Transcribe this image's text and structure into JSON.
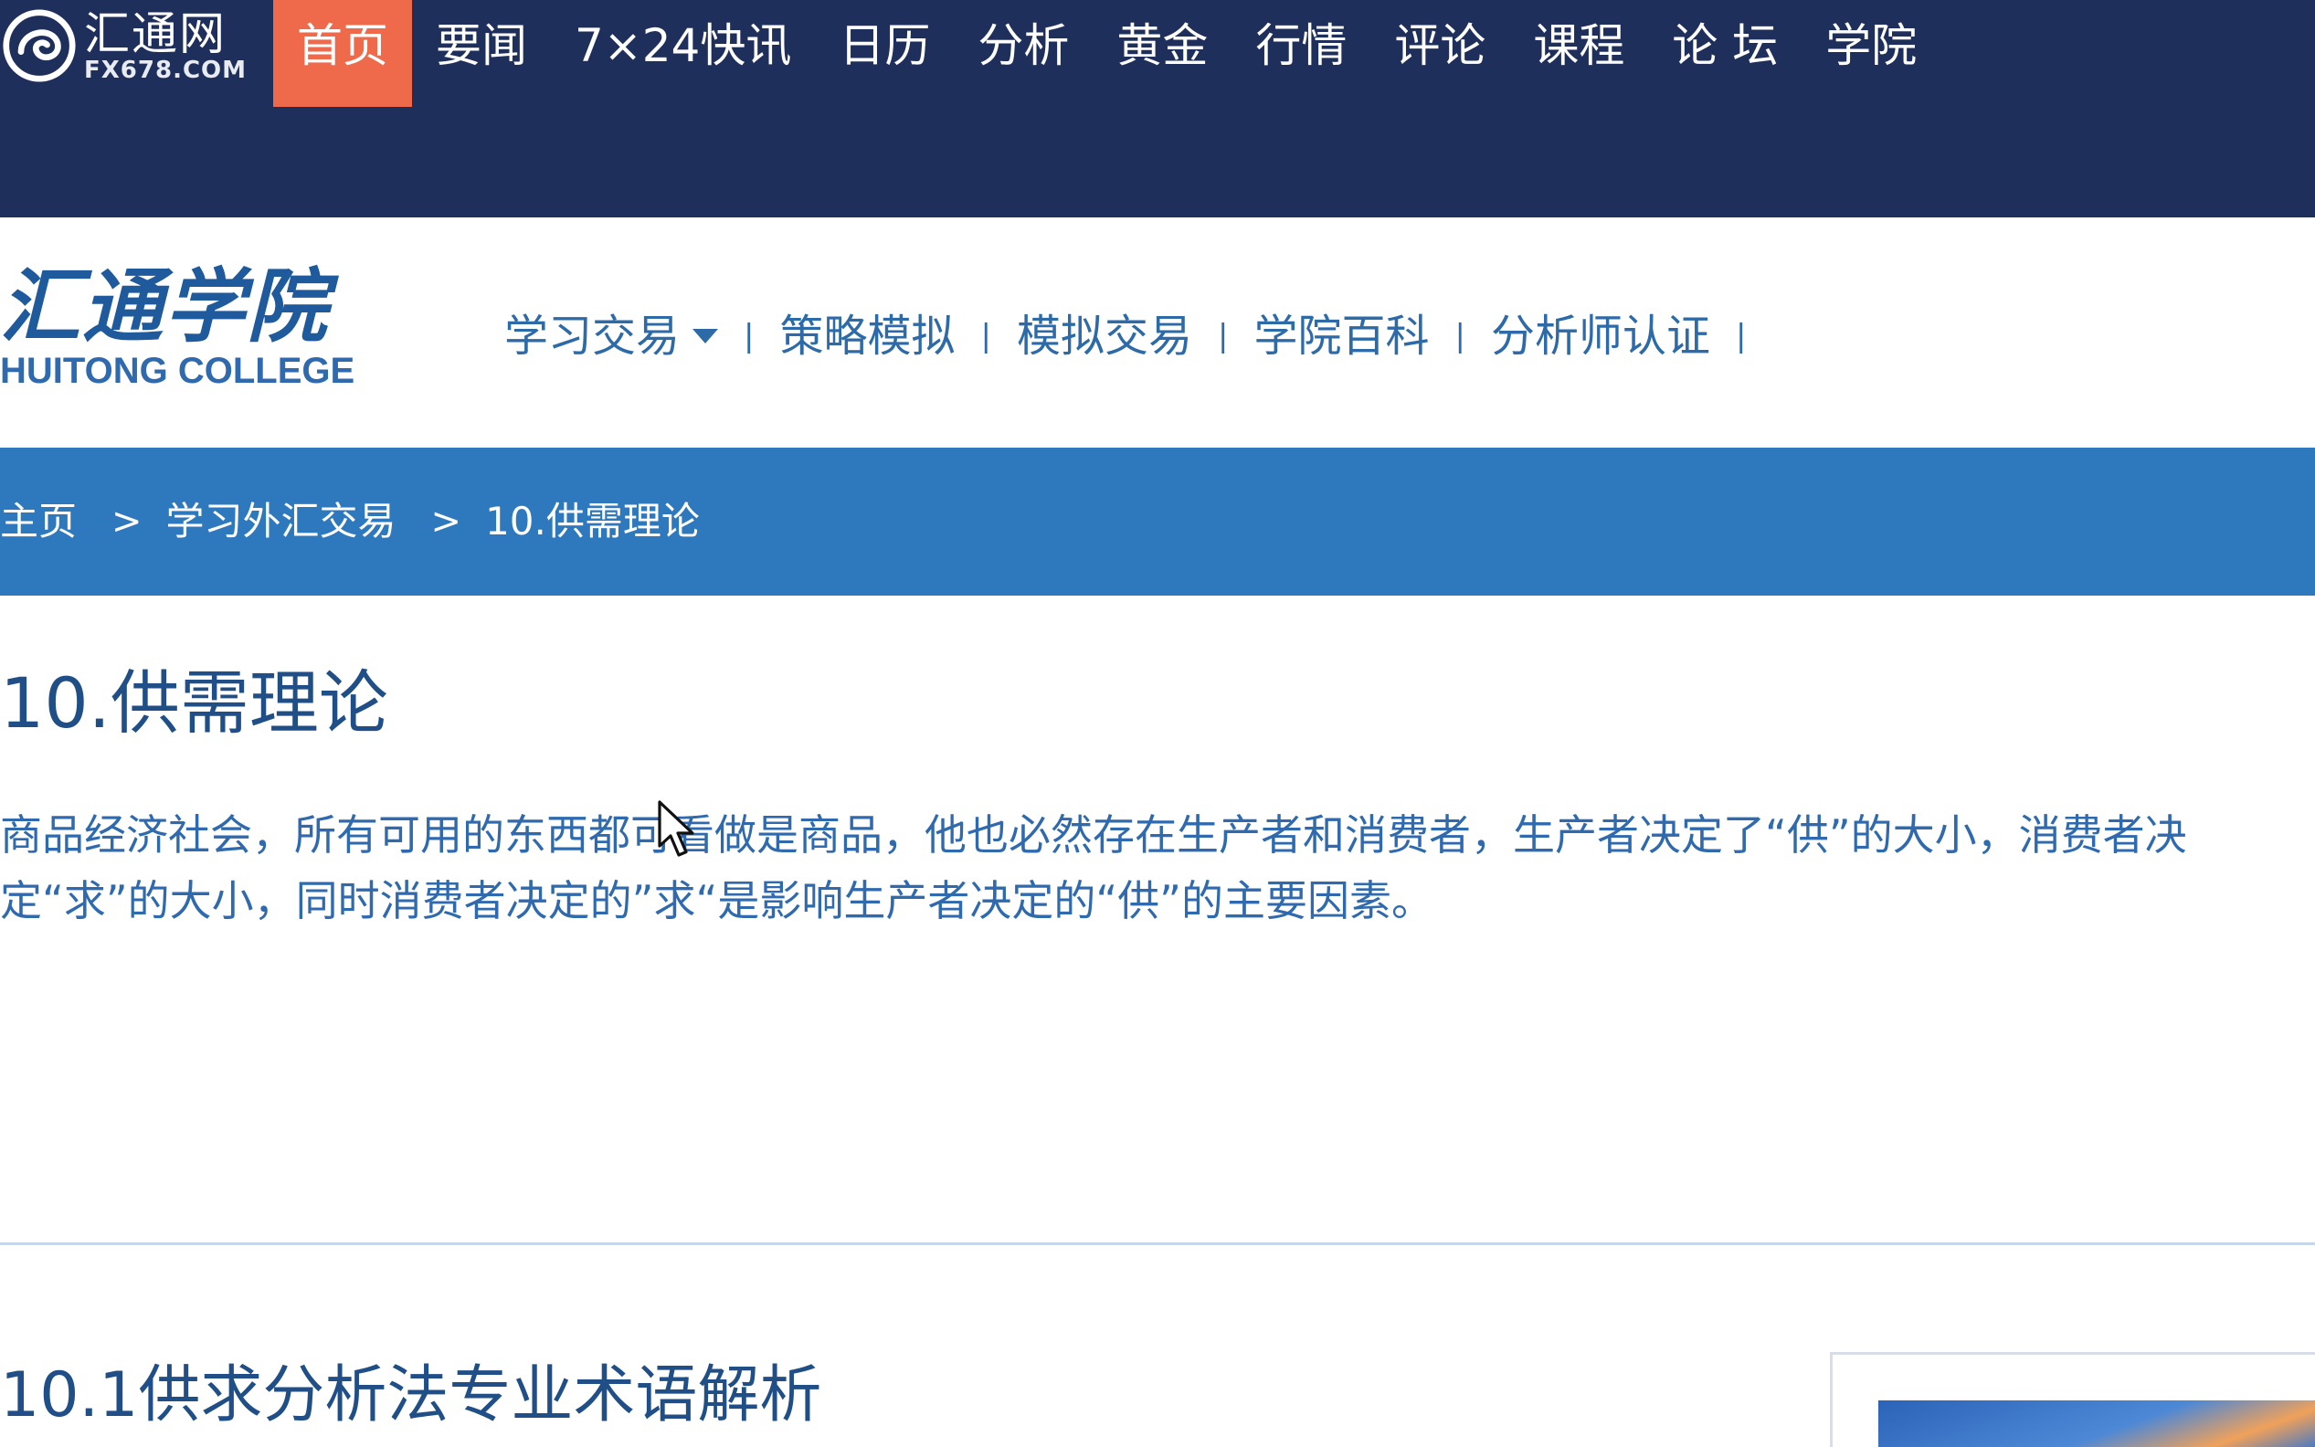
{
  "site": {
    "logo_cn": "汇通网",
    "logo_en": "FX678.COM"
  },
  "topnav": {
    "items": [
      {
        "label": "首页",
        "active": true
      },
      {
        "label": "要闻"
      },
      {
        "label": "7×24快讯"
      },
      {
        "label": "日历"
      },
      {
        "label": "分析"
      },
      {
        "label": "黄金"
      },
      {
        "label": "行情"
      },
      {
        "label": "评论"
      },
      {
        "label": "课程"
      },
      {
        "label": "论 坛"
      },
      {
        "label": "学院"
      }
    ]
  },
  "college": {
    "logo_cn": "汇通学院",
    "logo_en": "HUITONG COLLEGE"
  },
  "subnav": {
    "items": [
      {
        "label": "学习交易"
      },
      {
        "label": "策略模拟"
      },
      {
        "label": "模拟交易"
      },
      {
        "label": "学院百科"
      },
      {
        "label": "分析师认证"
      }
    ],
    "separator": "|"
  },
  "breadcrumb": {
    "items": [
      "主页",
      "学习外汇交易",
      "10.供需理论"
    ],
    "separator": ">"
  },
  "article": {
    "title": "10.供需理论",
    "body": "商品经济社会，所有可用的东西都可看做是商品，他也必然存在生产者和消费者，生产者决定了“供”的大小，消费者决定“求”的大小，同时消费者决定的”求“是影响生产者决定的“供”的主要因素。",
    "section_title": "10.1供求分析法专业术语解析"
  },
  "colors": {
    "topbar_bg": "#1f2f5c",
    "active_tab": "#ee6a4b",
    "breadcrumb_bg": "#2e78be",
    "link_blue": "#2d6aa8"
  },
  "icons": {
    "site_logo": "swirl-logo-icon",
    "dropdown": "caret-down-icon",
    "cursor": "mouse-pointer-icon"
  }
}
